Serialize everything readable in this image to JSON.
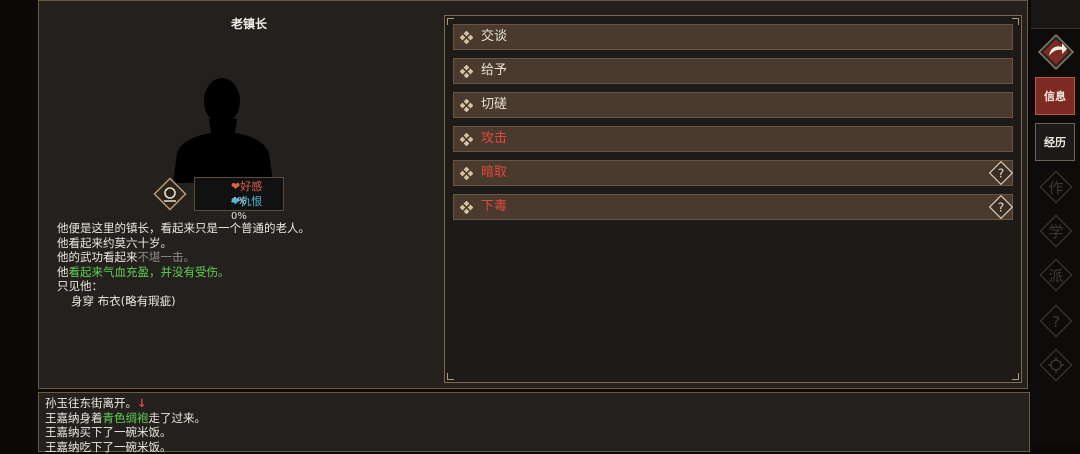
{
  "npc": {
    "name": "老镇长",
    "relations": [
      {
        "label": "好感",
        "value": "4%",
        "color": "#e0614a",
        "heart": "❤"
      },
      {
        "label": "仇恨",
        "value": "0%",
        "color": "#4fb7d8",
        "heart": "❤"
      }
    ],
    "description": {
      "line1": "他便是这里的镇长，看起来只是一个普通的老人。",
      "line2": "他看起来约莫六十岁。",
      "line3_prefix": "他的武功看起来",
      "line3_gray": "不堪一击。",
      "line4_prefix": "他",
      "line4_green": "看起来气血充盈，并没有受伤。",
      "line5": "只见他：",
      "line6": "身穿 布衣(略有瑕疵)"
    }
  },
  "actions": [
    {
      "label": "交谈",
      "danger": false,
      "help": false
    },
    {
      "label": "给予",
      "danger": false,
      "help": false
    },
    {
      "label": "切磋",
      "danger": false,
      "help": false
    },
    {
      "label": "攻击",
      "danger": true,
      "help": false
    },
    {
      "label": "暗取",
      "danger": true,
      "help": true
    },
    {
      "label": "下毒",
      "danger": true,
      "help": true
    }
  ],
  "help_symbol": "?",
  "log": {
    "line1": "孙玉往东街离开。",
    "line1_arrow": "↓",
    "line2_prefix": "王嘉纳身着",
    "line2_green": "青色绸袍",
    "line2_suffix": "走了过来。",
    "line3": "王嘉纳买下了一碗米饭。",
    "line4": "王嘉纳吃下了一碗米饭。"
  },
  "sidebar": {
    "info_label": "信息",
    "history_label": "经历",
    "ghost_labels": [
      "作",
      "学",
      "派"
    ],
    "ghost_help": "?"
  }
}
